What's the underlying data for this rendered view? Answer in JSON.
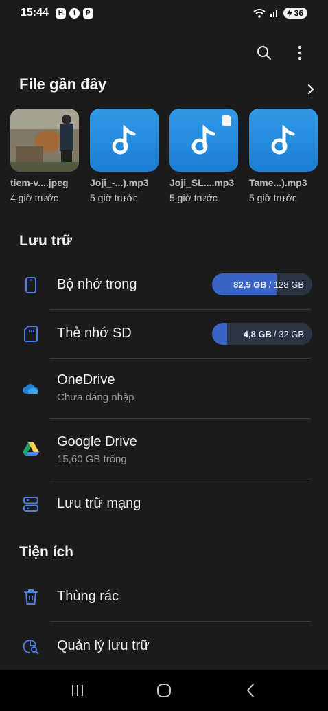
{
  "status_bar": {
    "time": "15:44",
    "app_badges": [
      "H",
      "f",
      "P"
    ],
    "battery": "36"
  },
  "toolbar": {
    "search_icon": "search-icon",
    "more_icon": "more-vert-icon"
  },
  "recent": {
    "title": "File gần đây",
    "items": [
      {
        "name": "tiem-v....jpeg",
        "time": "4 giờ trước",
        "type": "photo"
      },
      {
        "name": "Joji_-...).mp3",
        "time": "5 giờ trước",
        "type": "music"
      },
      {
        "name": "Joji_SL....mp3",
        "time": "5 giờ trước",
        "type": "music",
        "sd": true
      },
      {
        "name": "Tame...).mp3",
        "time": "5 giờ trước",
        "type": "music"
      }
    ]
  },
  "storage": {
    "title": "Lưu trữ",
    "internal": {
      "label": "Bộ nhớ trong",
      "used": "82,5 GB",
      "total": "/ 128 GB",
      "fraction": 0.645
    },
    "sd": {
      "label": "Thẻ nhớ SD",
      "used": "4,8 GB",
      "total": "/ 32 GB",
      "fraction": 0.15
    },
    "onedrive": {
      "label": "OneDrive",
      "sub": "Chưa đăng nhập"
    },
    "gdrive": {
      "label": "Google Drive",
      "sub": "15,60 GB trống"
    },
    "network": {
      "label": "Lưu trữ mạng"
    }
  },
  "utilities": {
    "title": "Tiện ích",
    "trash": {
      "label": "Thùng rác"
    },
    "manage": {
      "label": "Quản lý lưu trữ"
    }
  },
  "colors": {
    "accent": "#3b64c8",
    "icon_blue": "#4c7fe6",
    "background": "#1b1b1b"
  }
}
